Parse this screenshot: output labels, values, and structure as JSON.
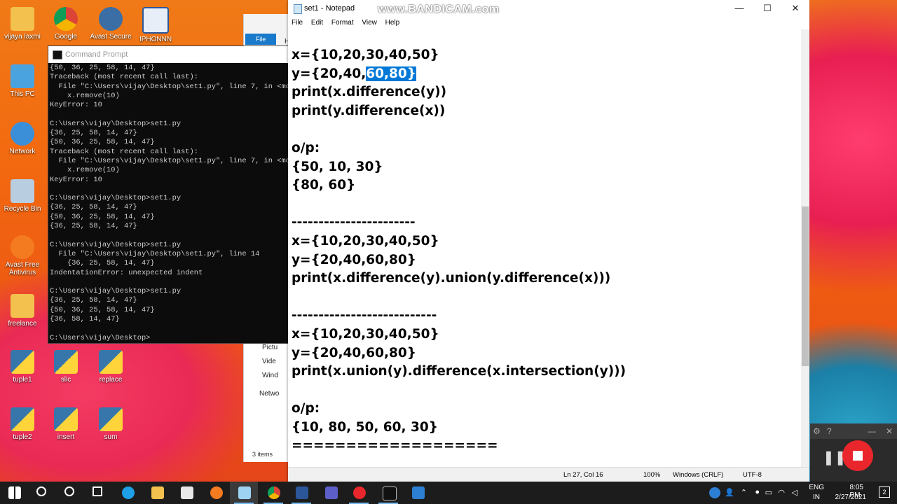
{
  "desktop_icons": [
    {
      "label": "vijaya laxmi",
      "icon": "user-folder-icon",
      "color": "#f2c14e"
    },
    {
      "label": "Google",
      "icon": "chrome-icon",
      "color": "#4285f4"
    },
    {
      "label": "Avast Secure",
      "icon": "avast-browser-icon",
      "color": "#3a6ea5"
    },
    {
      "label": "IPHONNN",
      "icon": "word-doc-icon",
      "color": "#2b579a"
    },
    {
      "label": "This PC",
      "icon": "this-pc-icon",
      "color": "#4aa3df"
    },
    {
      "label": "Network",
      "icon": "network-icon",
      "color": "#3b8fd8"
    },
    {
      "label": "Recycle Bin",
      "icon": "recycle-bin-icon",
      "color": "#b8cde0"
    },
    {
      "label": "Avast Free Antivirus",
      "icon": "avast-antivirus-icon",
      "color": "#f47b20"
    },
    {
      "label": "freelance",
      "icon": "folder-icon",
      "color": "#f2c14e"
    },
    {
      "label": "tuple1",
      "icon": "python-file-icon",
      "color": "#3776ab"
    },
    {
      "label": "slic",
      "icon": "python-file-icon",
      "color": "#3776ab"
    },
    {
      "label": "replace",
      "icon": "python-file-icon",
      "color": "#3776ab"
    },
    {
      "label": "tuple2",
      "icon": "python-file-icon",
      "color": "#3776ab"
    },
    {
      "label": "insert",
      "icon": "python-file-icon",
      "color": "#3776ab"
    },
    {
      "label": "sum",
      "icon": "python-file-icon",
      "color": "#3776ab"
    }
  ],
  "cmd": {
    "title": "Command Prompt",
    "text": "{50, 36, 25, 58, 14, 47}\nTraceback (most recent call last):\n  File \"C:\\Users\\vijay\\Desktop\\set1.py\", line 7, in <modu\n    x.remove(10)\nKeyError: 10\n\nC:\\Users\\vijay\\Desktop>set1.py\n{36, 25, 58, 14, 47}\n{50, 36, 25, 58, 14, 47}\nTraceback (most recent call last):\n  File \"C:\\Users\\vijay\\Desktop\\set1.py\", line 7, in <modu\n    x.remove(10)\nKeyError: 10\n\nC:\\Users\\vijay\\Desktop>set1.py\n{36, 25, 58, 14, 47}\n{50, 36, 25, 58, 14, 47}\n{36, 25, 58, 14, 47}\n\nC:\\Users\\vijay\\Desktop>set1.py\n  File \"C:\\Users\\vijay\\Desktop\\set1.py\", line 14\n    {36, 25, 58, 14, 47}\nIndentationError: unexpected indent\n\nC:\\Users\\vijay\\Desktop>set1.py\n{36, 25, 58, 14, 47}\n{50, 36, 25, 58, 14, 47}\n{36, 58, 14, 47}\n\nC:\\Users\\vijay\\Desktop>"
  },
  "explorer": {
    "file_tab": "File",
    "h_label": "H",
    "nav": [
      "Pictu",
      "Vide",
      "Wind",
      "Netwo"
    ],
    "status": "3 items"
  },
  "notepad": {
    "title": "set1 - Notepad",
    "watermark": "www.BANDICAM.com",
    "menu": [
      "File",
      "Edit",
      "Format",
      "View",
      "Help"
    ],
    "lines_before_sel": "x={10,20,30,40,50}",
    "line2_prefix": "y={20,40,",
    "line2_selected": "60,80}",
    "lines": [
      "print(x.difference(y))",
      "print(y.difference(x))",
      "",
      "o/p:",
      "{50, 10, 30}",
      "{80, 60}",
      "",
      "-----------------------",
      "x={10,20,30,40,50}",
      "y={20,40,60,80}",
      "print(x.difference(y).union(y.difference(x)))",
      "",
      "---------------------------",
      "x={10,20,30,40,50}",
      "y={20,40,60,80}",
      "print(x.union(y).difference(x.intersection(y)))",
      "",
      "o/p:",
      "{10, 80, 50, 60, 30}",
      "==================="
    ],
    "status": {
      "position": "Ln 27, Col 16",
      "zoom": "100%",
      "line_ending": "Windows (CRLF)",
      "encoding": "UTF-8"
    },
    "window_buttons": [
      "—",
      "☐",
      "✕"
    ]
  },
  "recorder": {
    "gear": "⚙",
    "help": "?",
    "minimize": "—",
    "close": "✕",
    "pause": "❚❚"
  },
  "taskbar": {
    "apps": [
      "windows-start-icon",
      "search-icon",
      "cortana-icon",
      "task-view-icon",
      "edge-icon",
      "file-explorer-icon",
      "store-icon",
      "avast-browser-icon",
      "notepad-icon",
      "chrome-icon",
      "word-icon",
      "teams-icon",
      "bandicam-icon",
      "cmd-icon",
      "pinned-app-icon"
    ],
    "lang_top": "ENG",
    "lang_bottom": "IN",
    "time": "8:05 PM",
    "date": "2/27/2021",
    "notifications": "2"
  }
}
